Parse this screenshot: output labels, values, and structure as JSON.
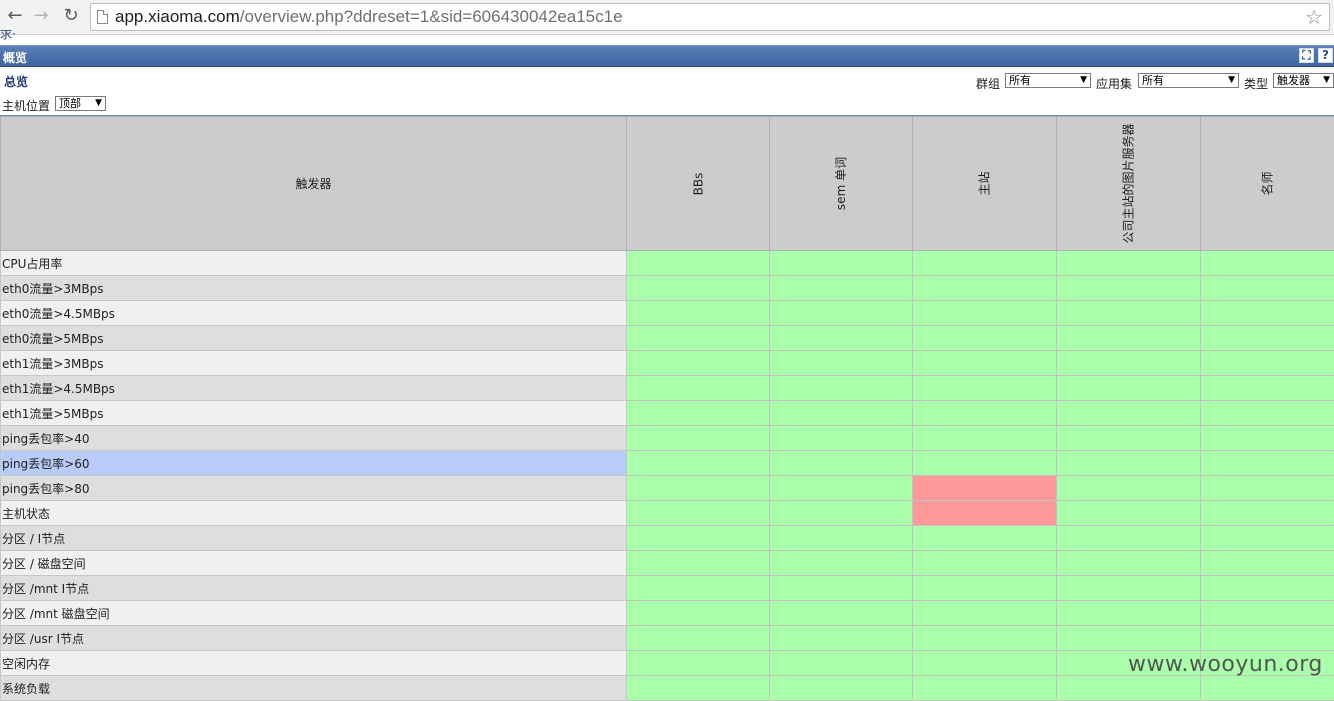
{
  "browser": {
    "url_host": "app.xiaoma.com",
    "url_path": "/overview.php?ddreset=1&sid=606430042ea15c1e",
    "back_icon": "back-arrow-icon",
    "forward_icon": "forward-arrow-icon",
    "reload_icon": "reload-icon",
    "bookmark_icon": "star-icon"
  },
  "cut_text": "求·",
  "title_bar": {
    "title": "概览",
    "fullscreen_icon": "fullscreen-icon",
    "help_label": "?"
  },
  "filters": {
    "section_title": "总览",
    "group_label": "群组",
    "group_value": "所有",
    "app_label": "应用集",
    "app_value": "所有",
    "type_label": "类型",
    "type_value": "触发器",
    "host_location_label": "主机位置",
    "host_location_value": "顶部"
  },
  "table": {
    "header_first": "触发器",
    "hosts": [
      "BBs",
      "sem 单词",
      "主站",
      "公司主站的图片服务器",
      "名师"
    ],
    "rows": [
      {
        "name": "CPU占用率",
        "status": [
          "ok",
          "ok",
          "ok",
          "ok",
          "ok"
        ]
      },
      {
        "name": "eth0流量>3MBps",
        "status": [
          "ok",
          "ok",
          "ok",
          "ok",
          "ok"
        ]
      },
      {
        "name": "eth0流量>4.5MBps",
        "status": [
          "ok",
          "ok",
          "ok",
          "ok",
          "ok"
        ]
      },
      {
        "name": "eth0流量>5MBps",
        "status": [
          "ok",
          "ok",
          "ok",
          "ok",
          "ok"
        ]
      },
      {
        "name": "eth1流量>3MBps",
        "status": [
          "ok",
          "ok",
          "ok",
          "ok",
          "ok"
        ]
      },
      {
        "name": "eth1流量>4.5MBps",
        "status": [
          "ok",
          "ok",
          "ok",
          "ok",
          "ok"
        ]
      },
      {
        "name": "eth1流量>5MBps",
        "status": [
          "ok",
          "ok",
          "ok",
          "ok",
          "ok"
        ]
      },
      {
        "name": "ping丢包率>40",
        "status": [
          "ok",
          "ok",
          "ok",
          "ok",
          "ok"
        ]
      },
      {
        "name": "ping丢包率>60",
        "status": [
          "ok",
          "ok",
          "ok",
          "ok",
          "ok"
        ]
      },
      {
        "name": "ping丢包率>80",
        "status": [
          "ok",
          "ok",
          "problem",
          "ok",
          "ok"
        ]
      },
      {
        "name": "主机状态",
        "status": [
          "ok",
          "ok",
          "problem",
          "ok",
          "ok"
        ]
      },
      {
        "name": "分区 / I节点",
        "status": [
          "ok",
          "ok",
          "ok",
          "ok",
          "ok"
        ]
      },
      {
        "name": "分区 / 磁盘空间",
        "status": [
          "ok",
          "ok",
          "ok",
          "ok",
          "ok"
        ]
      },
      {
        "name": "分区 /mnt I节点",
        "status": [
          "ok",
          "ok",
          "ok",
          "ok",
          "ok"
        ]
      },
      {
        "name": "分区 /mnt 磁盘空间",
        "status": [
          "ok",
          "ok",
          "ok",
          "ok",
          "ok"
        ]
      },
      {
        "name": "分区 /usr I节点",
        "status": [
          "ok",
          "ok",
          "ok",
          "ok",
          "ok"
        ]
      },
      {
        "name": "空闲内存",
        "status": [
          "ok",
          "ok",
          "ok",
          "ok",
          "ok"
        ]
      },
      {
        "name": "系统负载",
        "status": [
          "ok",
          "ok",
          "ok",
          "ok",
          "ok"
        ]
      }
    ],
    "selected_row": "ping丢包率>60",
    "colors": {
      "ok": "#aaffaa",
      "problem": "#ff9999",
      "selected": "#b9cbf9"
    }
  },
  "watermark": "www.wooyun.org"
}
